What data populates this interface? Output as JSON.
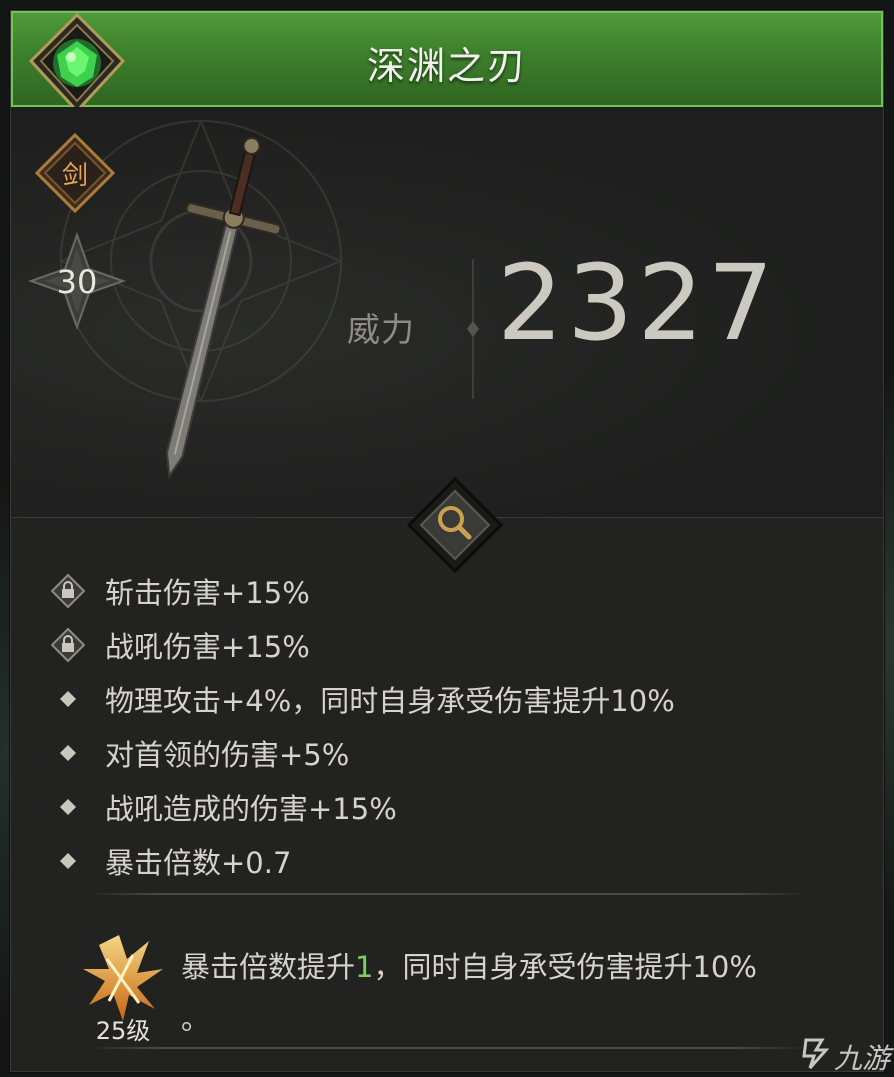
{
  "item": {
    "name": "深渊之刃",
    "type_label": "剑",
    "level": "30",
    "power_label": "威力",
    "power_value": "2327",
    "rarity_color": "#4f9a3a"
  },
  "stats": [
    {
      "icon": "lock-icon",
      "text": "斩击伤害+15%"
    },
    {
      "icon": "lock-icon",
      "text": "战吼伤害+15%"
    },
    {
      "icon": "diamond-bullet-icon",
      "text": "物理攻击+4%，同时自身承受伤害提升10%"
    },
    {
      "icon": "diamond-bullet-icon",
      "text": "对首领的伤害+5%"
    },
    {
      "icon": "diamond-bullet-icon",
      "text": "战吼造成的伤害+15%"
    },
    {
      "icon": "diamond-bullet-icon",
      "text": "暴击倍数+0.7"
    }
  ],
  "awaken": {
    "level_label": "25级",
    "text_before": "暴击倍数提升",
    "highlight": "1",
    "text_after": "，同时自身承受伤害提升10%",
    "text_tail": "。"
  },
  "watermark": "九游"
}
